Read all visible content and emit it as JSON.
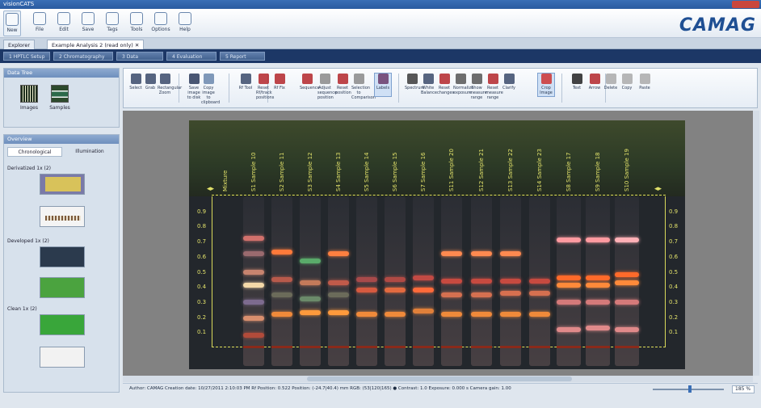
{
  "window": {
    "title": "visionCATS"
  },
  "toolbar": {
    "items": [
      {
        "label": "New"
      },
      {
        "label": "File"
      },
      {
        "label": "Edit"
      },
      {
        "label": "Save"
      },
      {
        "label": "Tags"
      },
      {
        "label": "Tools"
      },
      {
        "label": "Options"
      },
      {
        "label": "Help"
      }
    ],
    "brand": "CAMAG"
  },
  "tabs": [
    {
      "label": "Explorer"
    },
    {
      "label": "Example Analysis 2 (read only) ✕"
    }
  ],
  "workflow_steps": [
    {
      "label": "1   HPTLC Setup"
    },
    {
      "label": "2   Chromatography"
    },
    {
      "label": "3   Data"
    },
    {
      "label": "4   Evaluation"
    },
    {
      "label": "5   Report"
    }
  ],
  "data_tree": {
    "title": "Data Tree",
    "items": [
      {
        "label": "Images"
      },
      {
        "label": "Samples"
      }
    ]
  },
  "overview": {
    "title": "Overview",
    "tabs": [
      {
        "label": "Chronological"
      },
      {
        "label": "Illumination"
      }
    ],
    "groups": [
      {
        "label": "Derivatized 1x (2)"
      },
      {
        "label": "Developed 1x (2)"
      },
      {
        "label": "Clean 1x (2)"
      }
    ]
  },
  "ribbon": {
    "buttons": [
      {
        "label": "Select"
      },
      {
        "label": "Grab"
      },
      {
        "label": "Rectangular Zoom"
      },
      {
        "label": "Save image to disk"
      },
      {
        "label": "Copy image to clipboard"
      },
      {
        "label": "Rf Tool"
      },
      {
        "label": "Reset Rf/track positions"
      },
      {
        "label": "Rf Fix"
      },
      {
        "label": "Sequence"
      },
      {
        "label": "Adjust sequence position"
      },
      {
        "label": "Reset position"
      },
      {
        "label": "Selection to Comparison"
      },
      {
        "label": "Labels"
      },
      {
        "label": "Spectrum"
      },
      {
        "label": "White Balance"
      },
      {
        "label": "Reset changes"
      },
      {
        "label": "Normalize exposure"
      },
      {
        "label": "Show measure range"
      },
      {
        "label": "Reset measure range"
      },
      {
        "label": "Clarify"
      },
      {
        "label": "Crop Image"
      },
      {
        "label": "Text"
      },
      {
        "label": "Arrow"
      },
      {
        "label": "Delete"
      },
      {
        "label": "Copy"
      },
      {
        "label": "Paste"
      }
    ]
  },
  "plate": {
    "tracks": [
      {
        "label": "Mixture"
      },
      {
        "label": "S1   Sample 10"
      },
      {
        "label": "S2   Sample 11"
      },
      {
        "label": "S3   Sample 12"
      },
      {
        "label": "S4   Sample 13"
      },
      {
        "label": "S5   Sample 14"
      },
      {
        "label": "S6   Sample 15"
      },
      {
        "label": "S7   Sample 16"
      },
      {
        "label": "S11  Sample 20"
      },
      {
        "label": "S12  Sample 21"
      },
      {
        "label": "S13  Sample 22"
      },
      {
        "label": "S14  Sample 23"
      },
      {
        "label": "S8   Sample 17"
      },
      {
        "label": "S9   Sample 18"
      },
      {
        "label": "S10  Sample 19"
      }
    ],
    "rf_ticks": [
      "0.9",
      "0.8",
      "0.7",
      "0.6",
      "0.5",
      "0.4",
      "0.3",
      "0.2",
      "0.1"
    ],
    "lanes": [
      {
        "bands": [
          [
            0.08,
            "#b24b3a"
          ],
          [
            0.19,
            "#d98f6e"
          ],
          [
            0.3,
            "#7d6b8f"
          ],
          [
            0.41,
            "#f4d9a8"
          ],
          [
            0.5,
            "#c7846f"
          ],
          [
            0.62,
            "#9a6a6e"
          ],
          [
            0.72,
            "#d2716c"
          ]
        ]
      },
      {
        "bands": [
          [
            0.22,
            "#f08a3a"
          ],
          [
            0.35,
            "#6b6b5a"
          ],
          [
            0.45,
            "#b85a4b"
          ],
          [
            0.63,
            "#ff7a3a"
          ]
        ]
      },
      {
        "bands": [
          [
            0.23,
            "#ff9a3c"
          ],
          [
            0.32,
            "#6b8a6a"
          ],
          [
            0.43,
            "#c47a5a"
          ],
          [
            0.57,
            "#5aaa6a"
          ]
        ]
      },
      {
        "bands": [
          [
            0.23,
            "#ff9a3c"
          ],
          [
            0.35,
            "#6b6b5a"
          ],
          [
            0.43,
            "#c05a4a"
          ],
          [
            0.62,
            "#ff8040"
          ]
        ]
      },
      {
        "bands": [
          [
            0.22,
            "#f08a3a"
          ],
          [
            0.38,
            "#d65a40"
          ],
          [
            0.45,
            "#a84a4a"
          ]
        ]
      },
      {
        "bands": [
          [
            0.22,
            "#f08a3a"
          ],
          [
            0.38,
            "#e26a40"
          ],
          [
            0.45,
            "#b04a44"
          ]
        ]
      },
      {
        "bands": [
          [
            0.24,
            "#e0803a"
          ],
          [
            0.38,
            "#ff6a3a"
          ],
          [
            0.46,
            "#c24a44"
          ]
        ]
      },
      {
        "bands": [
          [
            0.22,
            "#f08a3a"
          ],
          [
            0.35,
            "#d67050"
          ],
          [
            0.44,
            "#c74a40"
          ],
          [
            0.62,
            "#ff8a50"
          ]
        ]
      },
      {
        "bands": [
          [
            0.22,
            "#f08a3a"
          ],
          [
            0.35,
            "#d67050"
          ],
          [
            0.44,
            "#c74a40"
          ],
          [
            0.62,
            "#ff8a50"
          ]
        ]
      },
      {
        "bands": [
          [
            0.22,
            "#f08a3a"
          ],
          [
            0.36,
            "#d67050"
          ],
          [
            0.44,
            "#c74a40"
          ],
          [
            0.62,
            "#ff8a50"
          ]
        ]
      },
      {
        "bands": [
          [
            0.22,
            "#f08a3a"
          ],
          [
            0.36,
            "#d67050"
          ],
          [
            0.44,
            "#c74a40"
          ]
        ]
      },
      {
        "bands": [
          [
            0.12,
            "#e08a8a"
          ],
          [
            0.3,
            "#d57a7a"
          ],
          [
            0.41,
            "#ff8a3a"
          ],
          [
            0.46,
            "#ff6a2a"
          ],
          [
            0.71,
            "#ff9aa0"
          ]
        ]
      },
      {
        "bands": [
          [
            0.13,
            "#e08a8a"
          ],
          [
            0.3,
            "#d57a7a"
          ],
          [
            0.41,
            "#ff8a3a"
          ],
          [
            0.46,
            "#ff6a2a"
          ],
          [
            0.71,
            "#ff9aa0"
          ]
        ]
      },
      {
        "bands": [
          [
            0.12,
            "#e08a8a"
          ],
          [
            0.3,
            "#d57a7a"
          ],
          [
            0.43,
            "#ff8a3a"
          ],
          [
            0.48,
            "#ff6a2a"
          ],
          [
            0.71,
            "#ffb0b6"
          ]
        ]
      }
    ]
  },
  "status": {
    "text": "Author: CAMAG    Creation date: 10/27/2011 2:10:03 PM    Rf Position: 0.522    Position: (-24.7|40.4) mm    RGB: (53|120|165)   ●   Contrast: 1.0    Exposure: 0.000 s    Camera gain: 1.00",
    "zoom": "185 %"
  }
}
